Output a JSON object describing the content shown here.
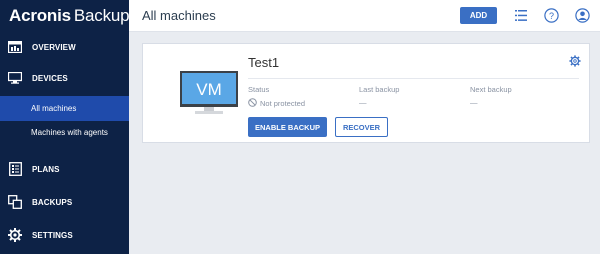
{
  "brand": {
    "name_bold": "Acronis",
    "name_light": "Backup"
  },
  "sidebar": {
    "items": [
      {
        "label": "OVERVIEW",
        "icon": "dashboard-icon"
      },
      {
        "label": "DEVICES",
        "icon": "monitor-icon"
      },
      {
        "label": "PLANS",
        "icon": "plans-icon"
      },
      {
        "label": "BACKUPS",
        "icon": "backups-icon"
      },
      {
        "label": "SETTINGS",
        "icon": "gear-icon"
      }
    ],
    "subitems": [
      {
        "label": "All machines",
        "active": true
      },
      {
        "label": "Machines with agents",
        "active": false
      }
    ]
  },
  "header": {
    "title": "All machines",
    "add_label": "ADD",
    "icons": [
      "list-icon",
      "help-icon",
      "account-icon"
    ]
  },
  "card": {
    "vm_label": "VM",
    "name": "Test1",
    "status_label": "Status",
    "status_value": "Not protected",
    "last_backup_label": "Last backup",
    "last_backup_value": "—",
    "next_backup_label": "Next backup",
    "next_backup_value": "—",
    "enable_backup_label": "ENABLE BACKUP",
    "recover_label": "RECOVER"
  },
  "colors": {
    "sidebar": "#0d2246",
    "active": "#1f4bab",
    "accent": "#3a6fc4"
  }
}
